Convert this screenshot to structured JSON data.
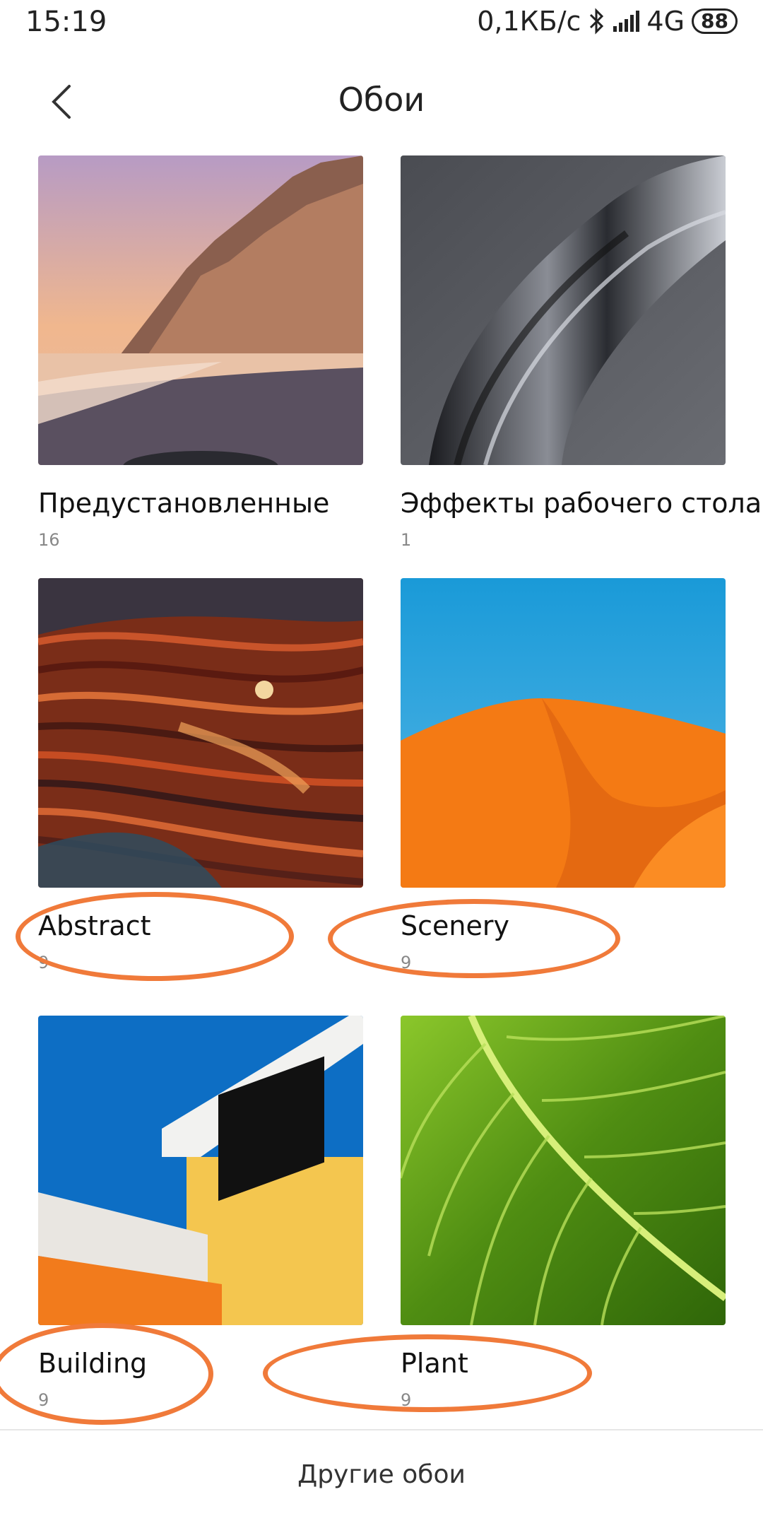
{
  "status_bar": {
    "time": "15:19",
    "speed": "0,1КБ/с",
    "network": "4G",
    "battery": "88",
    "icons": [
      "bluetooth-icon",
      "signal-icon",
      "battery-icon"
    ]
  },
  "header": {
    "title": "Обои",
    "back_icon": "chevron-left-icon"
  },
  "categories": [
    {
      "title": "Предустановленные",
      "count": "16",
      "theme": "mountain-beach"
    },
    {
      "title": "Эффекты рабочего стола",
      "count": "1",
      "theme": "silver-silk"
    },
    {
      "title": "Abstract",
      "count": "9",
      "theme": "orange-rock-layers",
      "circled": true
    },
    {
      "title": "Scenery",
      "count": "9",
      "theme": "orange-dune",
      "circled": true
    },
    {
      "title": "Building",
      "count": "9",
      "theme": "yellow-building",
      "circled": true
    },
    {
      "title": "Plant",
      "count": "9",
      "theme": "green-leaf",
      "circled": true
    }
  ],
  "bottom": {
    "label": "Другие обои"
  },
  "colors": {
    "annotation": "#f07a3a",
    "text": "#111111",
    "muted": "#888888"
  }
}
